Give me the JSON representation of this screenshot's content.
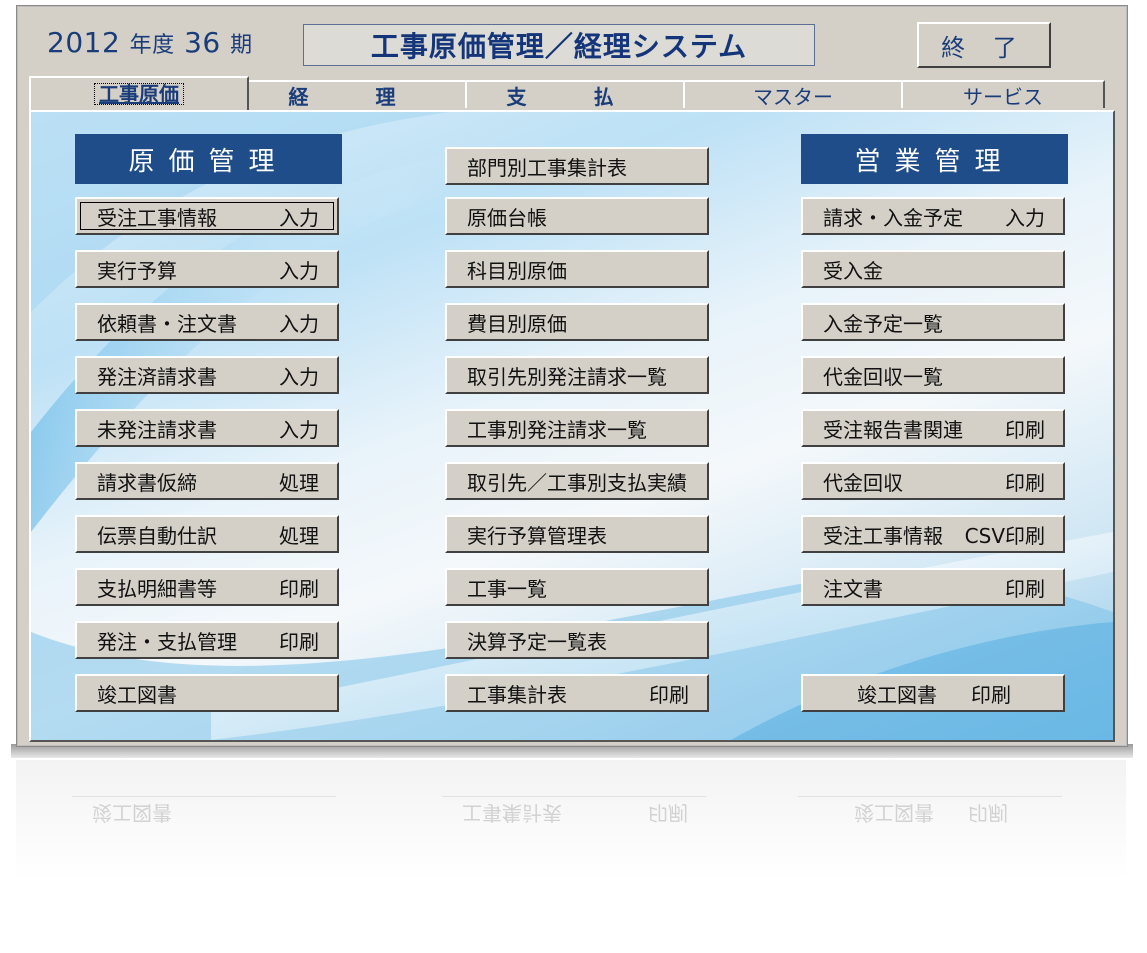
{
  "header": {
    "year": "2012",
    "year_suffix": "年度",
    "period": "36",
    "period_suffix": "期",
    "title": "工事原価管理／経理システム",
    "exit_label": "終 了"
  },
  "tabs": [
    {
      "label": "工事原価",
      "active": true
    },
    {
      "label": "経 理",
      "active": false
    },
    {
      "label": "支 払",
      "active": false
    },
    {
      "label": "マスター",
      "active": false
    },
    {
      "label": "サービス",
      "active": false
    }
  ],
  "left": {
    "heading": "原価管理",
    "buttons": [
      {
        "label": "受注工事情報",
        "action": "入力"
      },
      {
        "label": "実行予算",
        "action": "入力"
      },
      {
        "label": "依頼書・注文書",
        "action": "入力"
      },
      {
        "label": "発注済請求書",
        "action": "入力"
      },
      {
        "label": "未発注請求書",
        "action": "入力"
      },
      {
        "label": "請求書仮締",
        "action": "処理"
      },
      {
        "label": "伝票自動仕訳",
        "action": "処理"
      },
      {
        "label": "支払明細書等",
        "action": "印刷"
      },
      {
        "label": "発注・支払管理",
        "action": "印刷"
      },
      {
        "label": "竣工図書",
        "action": ""
      }
    ]
  },
  "middle": {
    "buttons": [
      {
        "label": "部門別工事集計表",
        "action": ""
      },
      {
        "label": "原価台帳",
        "action": ""
      },
      {
        "label": "科目別原価",
        "action": ""
      },
      {
        "label": "費目別原価",
        "action": ""
      },
      {
        "label": "取引先別発注請求一覧",
        "action": ""
      },
      {
        "label": "工事別発注請求一覧",
        "action": ""
      },
      {
        "label": "取引先／工事別支払実績",
        "action": ""
      },
      {
        "label": "実行予算管理表",
        "action": ""
      },
      {
        "label": "工事一覧",
        "action": ""
      },
      {
        "label": "決算予定一覧表",
        "action": ""
      },
      {
        "label": "工事集計表",
        "action": "印刷"
      }
    ]
  },
  "right": {
    "heading": "営業管理",
    "buttons": [
      {
        "label": "請求・入金予定",
        "action": "入力"
      },
      {
        "label": "受入金",
        "action": ""
      },
      {
        "label": "入金予定一覧",
        "action": ""
      },
      {
        "label": "代金回収一覧",
        "action": ""
      },
      {
        "label": "受注報告書関連",
        "action": "印刷"
      },
      {
        "label": "代金回収",
        "action": "印刷"
      },
      {
        "label": "受注工事情報",
        "action": "CSV印刷"
      },
      {
        "label": "注文書",
        "action": "印刷"
      },
      {
        "label": "竣工図書",
        "action": "印刷"
      }
    ]
  },
  "colors": {
    "heading_bg": "#1e4d8a",
    "accent_text": "#1a3d7a",
    "button_face": "#d4d0c8"
  }
}
